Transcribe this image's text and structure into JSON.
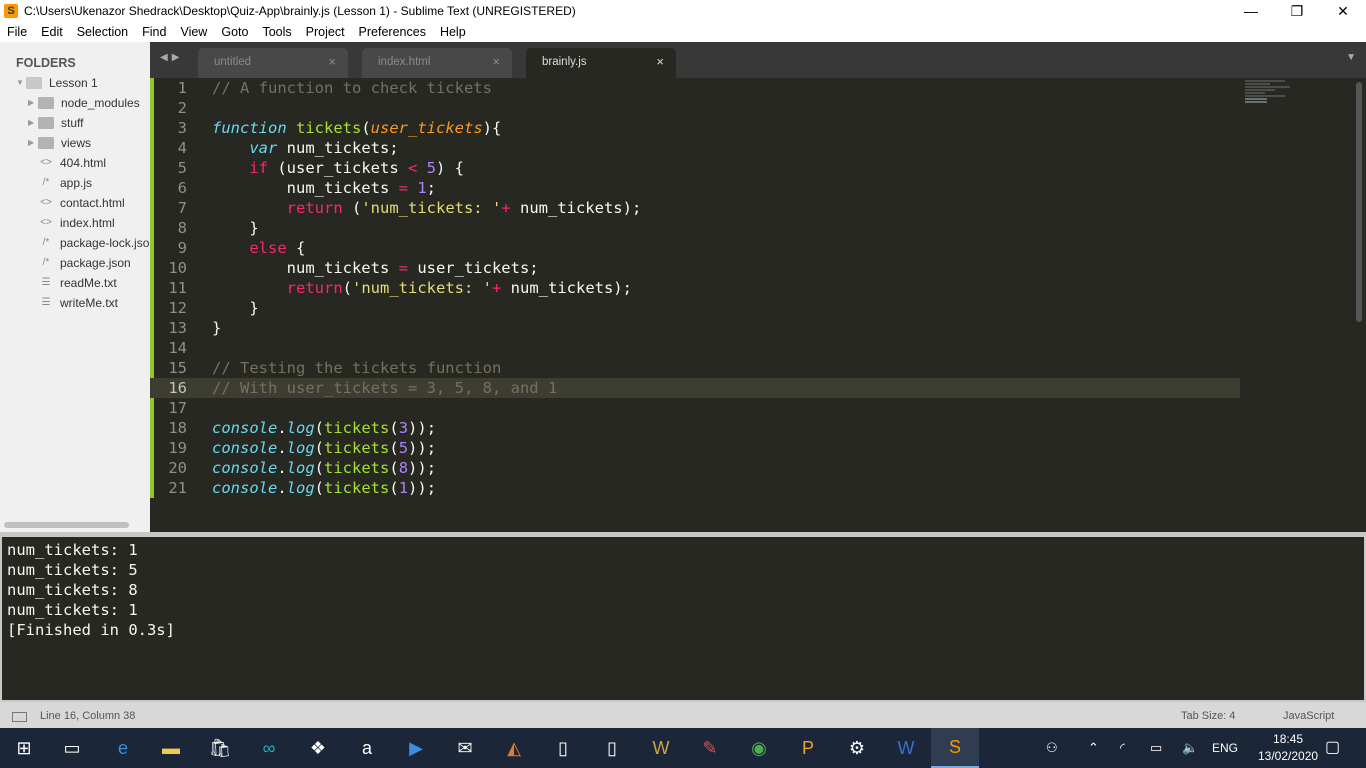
{
  "window": {
    "title": "C:\\Users\\Ukenazor Shedrack\\Desktop\\Quiz-App\\brainly.js (Lesson 1) - Sublime Text (UNREGISTERED)",
    "minimize": "—",
    "maximize": "❐",
    "close": "✕"
  },
  "menu": [
    "File",
    "Edit",
    "Selection",
    "Find",
    "View",
    "Goto",
    "Tools",
    "Project",
    "Preferences",
    "Help"
  ],
  "sidebar": {
    "header": "FOLDERS",
    "root": "Lesson 1",
    "items": [
      {
        "label": "node_modules",
        "type": "folder"
      },
      {
        "label": "stuff",
        "type": "folder"
      },
      {
        "label": "views",
        "type": "folder"
      },
      {
        "label": "404.html",
        "type": "html",
        "icon": "<>"
      },
      {
        "label": "app.js",
        "type": "js",
        "icon": "/*"
      },
      {
        "label": "contact.html",
        "type": "html",
        "icon": "<>"
      },
      {
        "label": "index.html",
        "type": "html",
        "icon": "<>"
      },
      {
        "label": "package-lock.json",
        "type": "js",
        "icon": "/*"
      },
      {
        "label": "package.json",
        "type": "js",
        "icon": "/*"
      },
      {
        "label": "readMe.txt",
        "type": "txt",
        "icon": "☰"
      },
      {
        "label": "writeMe.txt",
        "type": "txt",
        "icon": "☰"
      }
    ]
  },
  "tabs": [
    {
      "label": "untitled",
      "active": false
    },
    {
      "label": "index.html",
      "active": false
    },
    {
      "label": "brainly.js",
      "active": true
    }
  ],
  "tab_close": "×",
  "current_line": 16,
  "code": [
    [
      [
        "cm",
        "// A function to check tickets"
      ]
    ],
    [],
    [
      [
        "st",
        "function"
      ],
      [
        "tx",
        " "
      ],
      [
        "fn",
        "tickets"
      ],
      [
        "tx",
        "("
      ],
      [
        "pa",
        "user_tickets"
      ],
      [
        "tx",
        "){"
      ]
    ],
    [
      [
        "tx",
        "    "
      ],
      [
        "st",
        "var"
      ],
      [
        "tx",
        " num_tickets;"
      ]
    ],
    [
      [
        "tx",
        "    "
      ],
      [
        "kw",
        "if"
      ],
      [
        "tx",
        " (user_tickets "
      ],
      [
        "kw",
        "<"
      ],
      [
        "tx",
        " "
      ],
      [
        "nu",
        "5"
      ],
      [
        "tx",
        ") {"
      ]
    ],
    [
      [
        "tx",
        "        num_tickets "
      ],
      [
        "kw",
        "="
      ],
      [
        "tx",
        " "
      ],
      [
        "nu",
        "1"
      ],
      [
        "tx",
        ";"
      ]
    ],
    [
      [
        "tx",
        "        "
      ],
      [
        "kw",
        "return"
      ],
      [
        "tx",
        " ("
      ],
      [
        "s",
        "'num_tickets: '"
      ],
      [
        "kw",
        "+"
      ],
      [
        "tx",
        " num_tickets);"
      ]
    ],
    [
      [
        "tx",
        "    }"
      ]
    ],
    [
      [
        "tx",
        "    "
      ],
      [
        "kw",
        "else"
      ],
      [
        "tx",
        " {"
      ]
    ],
    [
      [
        "tx",
        "        num_tickets "
      ],
      [
        "kw",
        "="
      ],
      [
        "tx",
        " user_tickets;"
      ]
    ],
    [
      [
        "tx",
        "        "
      ],
      [
        "kw",
        "return"
      ],
      [
        "tx",
        "("
      ],
      [
        "s",
        "'num_tickets: '"
      ],
      [
        "kw",
        "+"
      ],
      [
        "tx",
        " num_tickets);"
      ]
    ],
    [
      [
        "tx",
        "    }"
      ]
    ],
    [
      [
        "tx",
        "}"
      ]
    ],
    [],
    [
      [
        "cm",
        "// Testing the tickets function"
      ]
    ],
    [
      [
        "cm",
        "// With user_tickets = 3, 5, 8, and 1"
      ]
    ],
    [],
    [
      [
        "st",
        "console"
      ],
      [
        "tx",
        "."
      ],
      [
        "st",
        "log"
      ],
      [
        "tx",
        "("
      ],
      [
        "fn",
        "tickets"
      ],
      [
        "tx",
        "("
      ],
      [
        "nu",
        "3"
      ],
      [
        "tx",
        "));"
      ]
    ],
    [
      [
        "st",
        "console"
      ],
      [
        "tx",
        "."
      ],
      [
        "st",
        "log"
      ],
      [
        "tx",
        "("
      ],
      [
        "fn",
        "tickets"
      ],
      [
        "tx",
        "("
      ],
      [
        "nu",
        "5"
      ],
      [
        "tx",
        "));"
      ]
    ],
    [
      [
        "st",
        "console"
      ],
      [
        "tx",
        "."
      ],
      [
        "st",
        "log"
      ],
      [
        "tx",
        "("
      ],
      [
        "fn",
        "tickets"
      ],
      [
        "tx",
        "("
      ],
      [
        "nu",
        "8"
      ],
      [
        "tx",
        "));"
      ]
    ],
    [
      [
        "st",
        "console"
      ],
      [
        "tx",
        "."
      ],
      [
        "st",
        "log"
      ],
      [
        "tx",
        "("
      ],
      [
        "fn",
        "tickets"
      ],
      [
        "tx",
        "("
      ],
      [
        "nu",
        "1"
      ],
      [
        "tx",
        "));"
      ]
    ]
  ],
  "output": [
    "num_tickets: 1",
    "num_tickets: 5",
    "num_tickets: 8",
    "num_tickets: 1",
    "[Finished in 0.3s]"
  ],
  "status": {
    "position": "Line 16, Column 38",
    "tab_size": "Tab Size: 4",
    "syntax": "JavaScript"
  },
  "taskbar": {
    "time": "18:45",
    "date": "13/02/2020",
    "lang": "ENG"
  }
}
